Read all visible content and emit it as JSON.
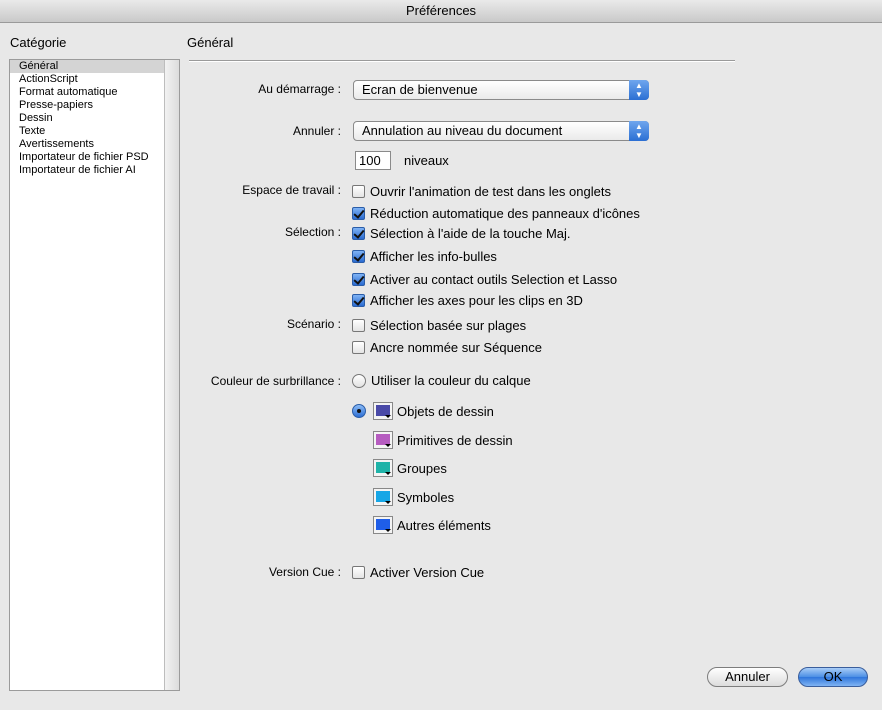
{
  "window": {
    "title": "Préférences"
  },
  "sidebar": {
    "title": "Catégorie",
    "items": [
      {
        "label": "Général",
        "selected": true
      },
      {
        "label": "ActionScript"
      },
      {
        "label": "Format automatique"
      },
      {
        "label": "Presse-papiers"
      },
      {
        "label": "Dessin"
      },
      {
        "label": "Texte"
      },
      {
        "label": "Avertissements"
      },
      {
        "label": "Importateur de fichier PSD"
      },
      {
        "label": "Importateur de fichier AI"
      }
    ]
  },
  "main": {
    "section_title": "Général",
    "startup": {
      "label": "Au démarrage :",
      "value": "Ecran de bienvenue"
    },
    "undo": {
      "label": "Annuler :",
      "value": "Annulation au niveau du document",
      "levels": "100",
      "levels_unit": "niveaux"
    },
    "workspace": {
      "label": "Espace de travail :",
      "options": [
        {
          "label": "Ouvrir l'animation de test dans les onglets",
          "checked": false
        },
        {
          "label": "Réduction automatique des panneaux d'icônes",
          "checked": true
        }
      ]
    },
    "selection": {
      "label": "Sélection :",
      "options": [
        {
          "label": "Sélection à l'aide de la touche Maj.",
          "checked": true
        },
        {
          "label": "Afficher les info-bulles",
          "checked": true
        },
        {
          "label": "Activer au contact outils Selection et Lasso",
          "checked": true
        },
        {
          "label": "Afficher les axes pour les clips en 3D",
          "checked": true
        }
      ]
    },
    "timeline": {
      "label": "Scénario :",
      "options": [
        {
          "label": "Sélection basée sur plages",
          "checked": false
        },
        {
          "label": "Ancre nommée sur Séquence",
          "checked": false
        }
      ]
    },
    "highlight": {
      "label": "Couleur de surbrillance :",
      "use_layer_color": {
        "label": "Utiliser la couleur du calque",
        "selected": false
      },
      "custom_selected": true,
      "swatches": [
        {
          "label": "Objets de dessin",
          "color": "#4a4aa8"
        },
        {
          "label": "Primitives de dessin",
          "color": "#b65cc0"
        },
        {
          "label": "Groupes",
          "color": "#1fb3a8"
        },
        {
          "label": "Symboles",
          "color": "#16a6e6"
        },
        {
          "label": "Autres éléments",
          "color": "#1f5ee8"
        }
      ]
    },
    "version_cue": {
      "label": "Version Cue :",
      "option": {
        "label": "Activer Version Cue",
        "checked": false
      }
    }
  },
  "buttons": {
    "cancel": "Annuler",
    "ok": "OK"
  }
}
